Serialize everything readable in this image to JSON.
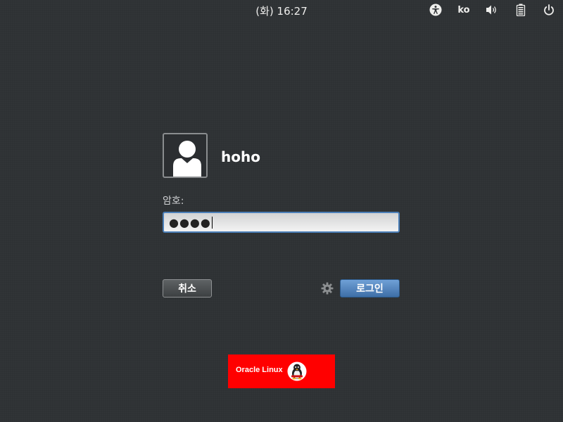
{
  "topbar": {
    "clock": "(화) 16:27",
    "language": "ko",
    "icons": [
      "accessibility-icon",
      "volume-icon",
      "battery-icon",
      "power-icon"
    ]
  },
  "login": {
    "username": "hoho",
    "password_label": "암호:",
    "password_mask": "●●●●",
    "cancel_label": "취소",
    "login_label": "로그인"
  },
  "logo": {
    "text": "Oracle Linux"
  },
  "colors": {
    "background": "#2e3134",
    "accent": "#4b7fb8",
    "logo_bg": "#ff0000"
  }
}
